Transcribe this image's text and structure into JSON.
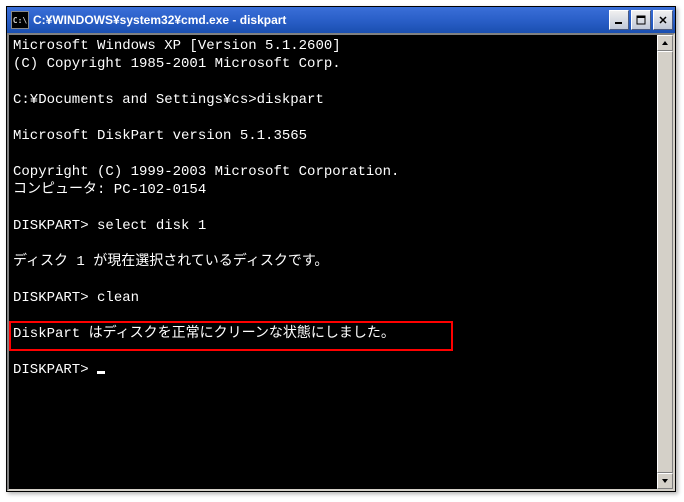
{
  "window": {
    "title": "C:¥WINDOWS¥system32¥cmd.exe - diskpart",
    "icon_label": "C:\\"
  },
  "terminal": {
    "lines": [
      "Microsoft Windows XP [Version 5.1.2600]",
      "(C) Copyright 1985-2001 Microsoft Corp.",
      "",
      "C:¥Documents and Settings¥cs>diskpart",
      "",
      "Microsoft DiskPart version 5.1.3565",
      "",
      "Copyright (C) 1999-2003 Microsoft Corporation.",
      "コンピュータ: PC-102-0154",
      "",
      "DISKPART> select disk 1",
      "",
      "ディスク 1 が現在選択されているディスクです。",
      "",
      "DISKPART> clean",
      "",
      "DiskPart はディスクを正常にクリーンな状態にしました。",
      "",
      "DISKPART> "
    ],
    "highlight_line_index": 16
  }
}
